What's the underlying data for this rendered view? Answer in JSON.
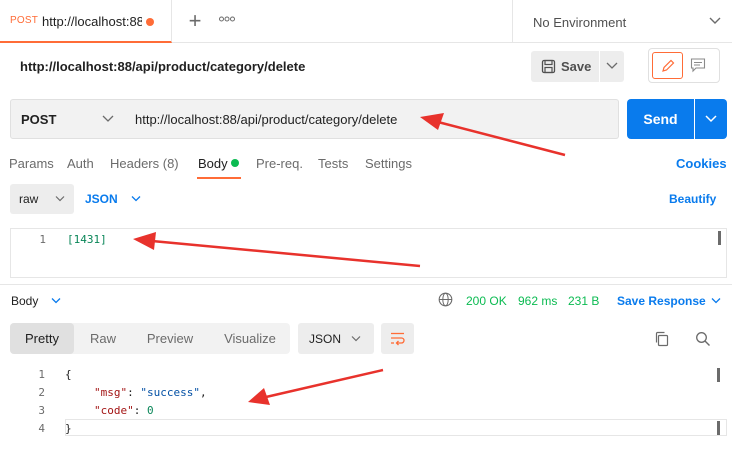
{
  "tabbar": {
    "tab": {
      "method": "POST",
      "url": "http://localhost:88"
    },
    "plus": "+",
    "more": "ooo",
    "environment": "No Environment"
  },
  "title": "http://localhost:88/api/product/category/delete",
  "toolbar": {
    "save_label": "Save"
  },
  "request": {
    "method": "POST",
    "url": "http://localhost:88/api/product/category/delete",
    "send_label": "Send"
  },
  "request_tabs": {
    "params": "Params",
    "auth": "Auth",
    "headers": "Headers (8)",
    "body": "Body",
    "prereq": "Pre-req.",
    "tests": "Tests",
    "settings": "Settings",
    "cookies": "Cookies"
  },
  "body_options": {
    "mode": "raw",
    "language": "JSON",
    "beautify": "Beautify"
  },
  "request_body": {
    "lines": [
      {
        "num": "1",
        "text": "[1431]"
      }
    ]
  },
  "response": {
    "body_label": "Body",
    "status": "200 OK",
    "time": "962 ms",
    "size": "231 B",
    "save_response": "Save Response",
    "views": [
      "Pretty",
      "Raw",
      "Preview",
      "Visualize"
    ],
    "format": "JSON",
    "lines": [
      {
        "num": "1",
        "brace": "{"
      },
      {
        "num": "2",
        "key": "\"msg\"",
        "colon": ": ",
        "value": "\"success\"",
        "comma": ","
      },
      {
        "num": "3",
        "key": "\"code\"",
        "colon": ": ",
        "value": "0"
      },
      {
        "num": "4",
        "brace": "}"
      }
    ]
  },
  "colors": {
    "accent": "#ff6c37",
    "primary": "#097bed",
    "success": "#0cbb52",
    "annotation": "#e8322c"
  }
}
